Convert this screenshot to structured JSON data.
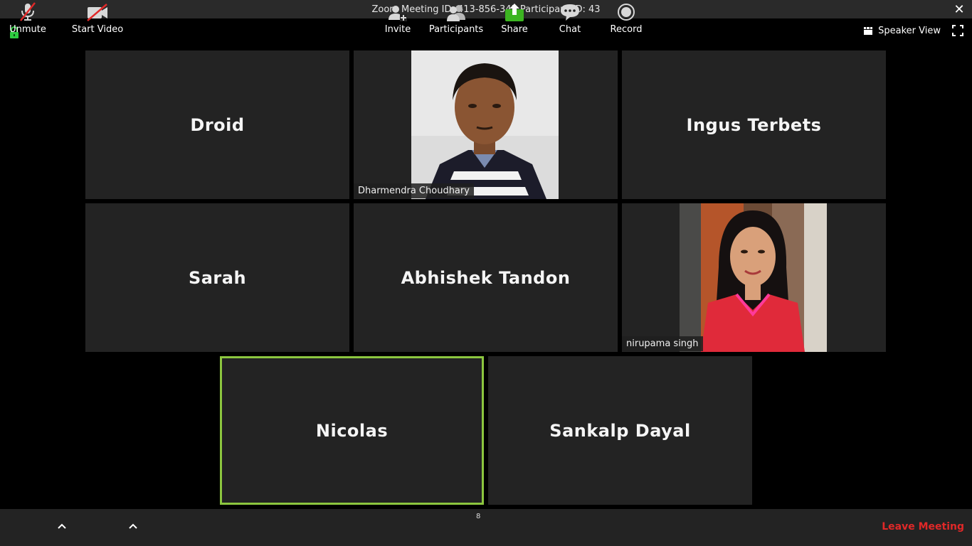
{
  "window": {
    "title": "Zoom Meeting ID: 413-856-345 Participant ID: 43"
  },
  "header": {
    "speaker_view_label": "Speaker View"
  },
  "participants": [
    {
      "name": "Droid",
      "video": false
    },
    {
      "name": "Dharmendra Choudhary",
      "video": true
    },
    {
      "name": "Ingus Terbets",
      "video": false
    },
    {
      "name": "Sarah",
      "video": false
    },
    {
      "name": "Abhishek Tandon",
      "video": false
    },
    {
      "name": "nirupama singh",
      "video": true
    },
    {
      "name": "Nicolas",
      "video": false,
      "active_speaker": true
    },
    {
      "name": "Sankalp Dayal",
      "video": false
    }
  ],
  "toolbar": {
    "unmute_label": "Unmute",
    "start_video_label": "Start Video",
    "invite_label": "Invite",
    "participants_label": "Participants",
    "participants_count": "8",
    "share_label": "Share",
    "chat_label": "Chat",
    "record_label": "Record",
    "leave_label": "Leave Meeting"
  },
  "colors": {
    "active_speaker_border": "#8cc63f",
    "share_green": "#3cb521",
    "leave_red": "#e02828",
    "lock_green": "#2ecc40"
  }
}
